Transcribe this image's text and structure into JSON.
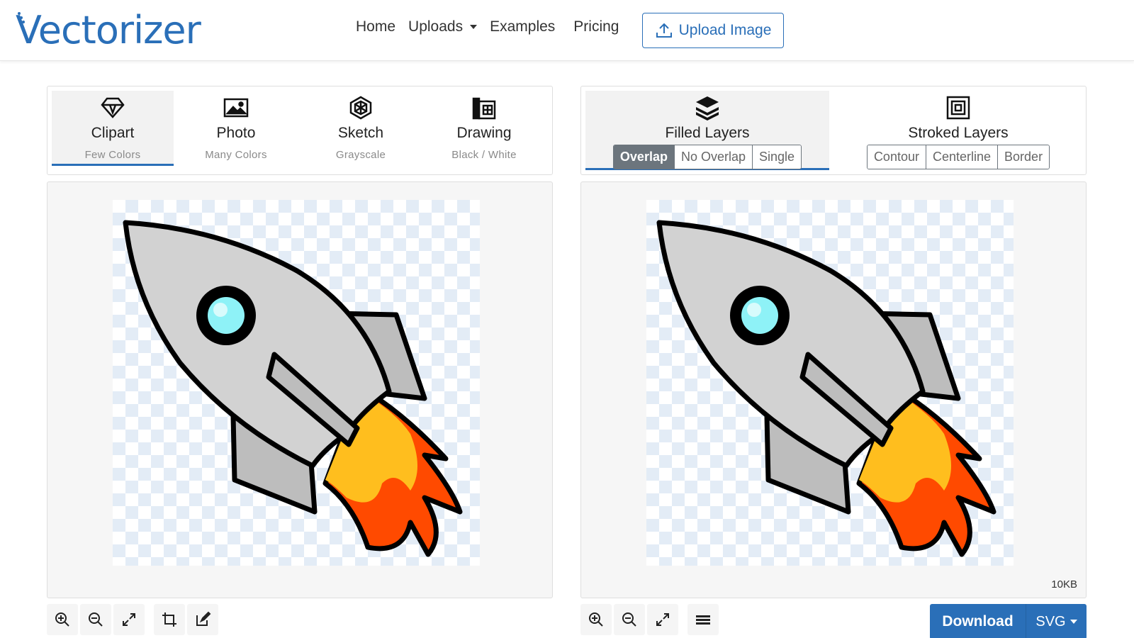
{
  "brand": {
    "name": "Vectorizer",
    "color": "#2a6fb8"
  },
  "nav": {
    "home": "Home",
    "uploads": "Uploads",
    "examples": "Examples",
    "pricing": "Pricing",
    "upload_button": "Upload Image"
  },
  "modes": [
    {
      "title": "Clipart",
      "subtitle": "Few Colors",
      "icon": "diamond-icon",
      "active": true
    },
    {
      "title": "Photo",
      "subtitle": "Many Colors",
      "icon": "image-icon",
      "active": false
    },
    {
      "title": "Sketch",
      "subtitle": "Grayscale",
      "icon": "pencil-tip-icon",
      "active": false
    },
    {
      "title": "Drawing",
      "subtitle": "Black / White",
      "icon": "sketchbook-icon",
      "active": false
    }
  ],
  "layers": {
    "filled": {
      "title": "Filled Layers",
      "options": [
        "Overlap",
        "No Overlap",
        "Single"
      ],
      "selected": "Overlap"
    },
    "stroked": {
      "title": "Stroked Layers",
      "options": [
        "Contour",
        "Centerline",
        "Border"
      ]
    }
  },
  "result": {
    "file_size": "10KB"
  },
  "download": {
    "label": "Download",
    "format": "SVG"
  }
}
